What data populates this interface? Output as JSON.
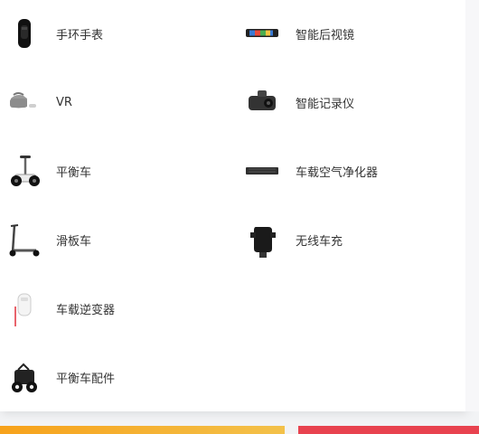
{
  "menu": {
    "items": [
      {
        "label": "手环手表",
        "icon": "smart-band-icon"
      },
      {
        "label": "智能后视镜",
        "icon": "rearview-mirror-icon"
      },
      {
        "label": "VR",
        "icon": "vr-headset-icon"
      },
      {
        "label": "智能记录仪",
        "icon": "dashcam-icon"
      },
      {
        "label": "平衡车",
        "icon": "balance-scooter-icon"
      },
      {
        "label": "车载空气净化器",
        "icon": "car-air-purifier-icon"
      },
      {
        "label": "滑板车",
        "icon": "kick-scooter-icon"
      },
      {
        "label": "无线车充",
        "icon": "wireless-car-charger-icon"
      },
      {
        "label": "车载逆变器",
        "icon": "car-inverter-icon"
      },
      {
        "label": "平衡车配件",
        "icon": "balance-scooter-accessory-icon"
      }
    ]
  },
  "colors": {
    "text": "#333333",
    "bar_left": "#f7a21b",
    "bar_right": "#e8424f"
  }
}
